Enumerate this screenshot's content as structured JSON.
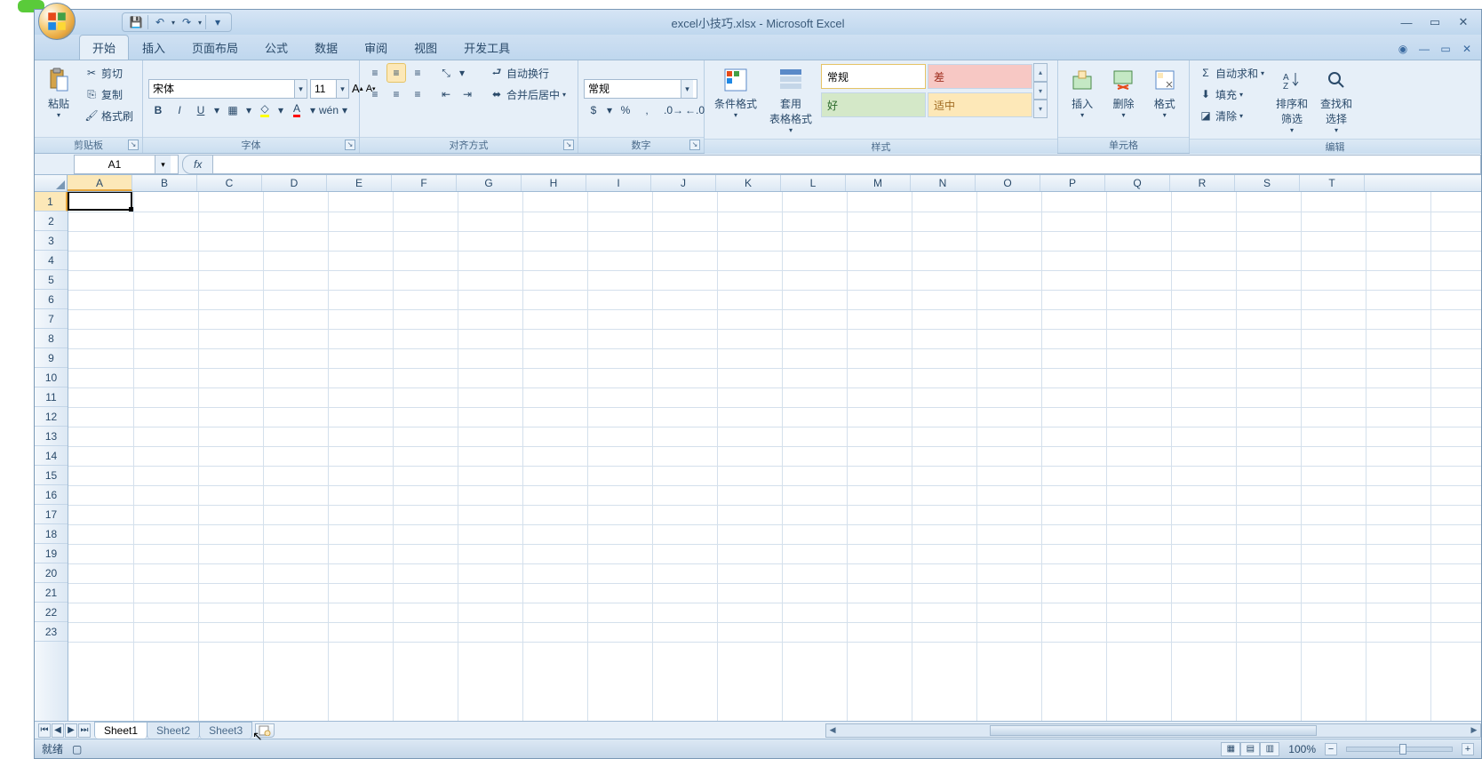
{
  "app": {
    "title": "excel小技巧.xlsx - Microsoft Excel"
  },
  "qat": {
    "save": "💾",
    "undo": "↶",
    "redo": "↷",
    "more": "▾"
  },
  "tabs": [
    {
      "label": "开始",
      "active": true
    },
    {
      "label": "插入"
    },
    {
      "label": "页面布局"
    },
    {
      "label": "公式"
    },
    {
      "label": "数据"
    },
    {
      "label": "审阅"
    },
    {
      "label": "视图"
    },
    {
      "label": "开发工具"
    }
  ],
  "clipboard": {
    "paste": "粘贴",
    "cut": "剪切",
    "copy": "复制",
    "format_painter": "格式刷",
    "group": "剪贴板"
  },
  "font": {
    "name": "宋体",
    "size": "11",
    "group": "字体"
  },
  "align": {
    "wrap": "自动换行",
    "merge": "合并后居中",
    "group": "对齐方式"
  },
  "number": {
    "format": "常规",
    "group": "数字"
  },
  "styles": {
    "cond_fmt": "条件格式",
    "table_fmt": "套用\n表格格式",
    "normal": "常规",
    "bad": "差",
    "good": "好",
    "neutral": "适中",
    "group": "样式"
  },
  "cells": {
    "insert": "插入",
    "delete": "删除",
    "format": "格式",
    "group": "单元格"
  },
  "editing": {
    "autosum": "自动求和",
    "fill": "填充",
    "clear": "清除",
    "sort": "排序和\n筛选",
    "find": "查找和\n选择",
    "group": "编辑"
  },
  "formula_bar": {
    "cell_ref": "A1",
    "fx": "fx"
  },
  "columns": [
    "A",
    "B",
    "C",
    "D",
    "E",
    "F",
    "G",
    "H",
    "I",
    "J",
    "K",
    "L",
    "M",
    "N",
    "O",
    "P",
    "Q",
    "R",
    "S",
    "T"
  ],
  "rows": [
    "1",
    "2",
    "3",
    "4",
    "5",
    "6",
    "7",
    "8",
    "9",
    "10",
    "11",
    "12",
    "13",
    "14",
    "15",
    "16",
    "17",
    "18",
    "19",
    "20",
    "21",
    "22",
    "23"
  ],
  "sheets": [
    {
      "name": "Sheet1",
      "active": true
    },
    {
      "name": "Sheet2"
    },
    {
      "name": "Sheet3"
    }
  ],
  "status": {
    "ready": "就绪",
    "zoom": "100%"
  }
}
